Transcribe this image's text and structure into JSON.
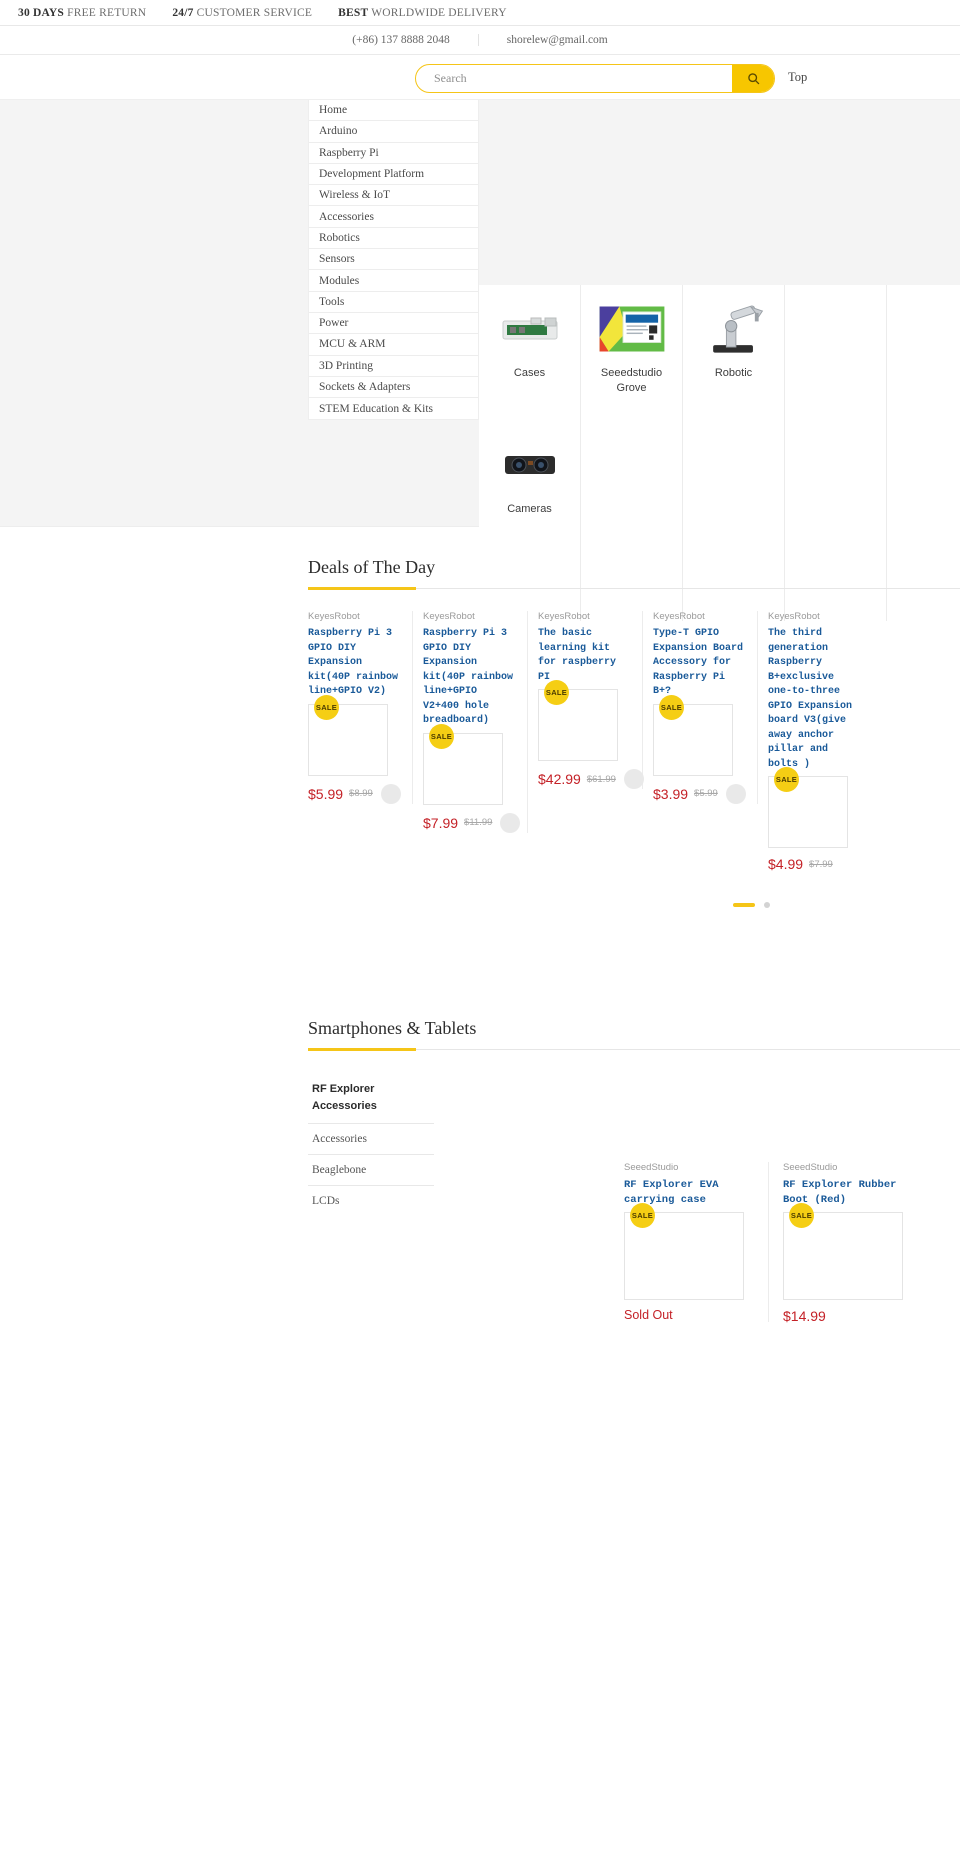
{
  "announcement": {
    "items": [
      {
        "strong": "30 DAYS",
        "rest": "FREE RETURN"
      },
      {
        "strong": "24/7",
        "rest": "CUSTOMER SERVICE"
      },
      {
        "strong": "BEST",
        "rest": "WORLDWIDE DELIVERY"
      }
    ]
  },
  "contact": {
    "phone": "(+86) 137 8888 2048",
    "email": "shorelew@gmail.com"
  },
  "search": {
    "placeholder": "Search",
    "value": "",
    "button_icon": "search-icon",
    "top_link": "Top"
  },
  "mega_menu": {
    "items": [
      {
        "label": "Home"
      },
      {
        "label": "Arduino"
      },
      {
        "label": "Raspberry Pi"
      },
      {
        "label": "Development Platform"
      },
      {
        "label": "Wireless & IoT"
      },
      {
        "label": "Accessories"
      },
      {
        "label": "Robotics"
      },
      {
        "label": "Sensors"
      },
      {
        "label": "Modules"
      },
      {
        "label": "Tools"
      },
      {
        "label": "Power"
      },
      {
        "label": "MCU & ARM"
      },
      {
        "label": "3D Printing"
      },
      {
        "label": "Sockets & Adapters"
      },
      {
        "label": "STEM Education & Kits"
      }
    ]
  },
  "mega_panel": {
    "categories": [
      {
        "label": "Cases",
        "image": "raspberry-pi-clear-case-image"
      },
      {
        "label": "Cameras",
        "image": "camera-module-image"
      },
      {
        "label": "Seeedstudio Grove",
        "image": "grove-base-kit-box-image"
      },
      {
        "label": "Robotic",
        "image": "robotic-arm-image"
      }
    ]
  },
  "deals": {
    "title": "Deals of The Day",
    "products": [
      {
        "vendor": "KeyesRobot",
        "title": "Raspberry Pi 3 GPIO DIY Expansion kit(40P rainbow line+GPIO V2)",
        "badge": "SALE",
        "price": "$5.99",
        "compare_price": "$8.99",
        "sold_out": false
      },
      {
        "vendor": "KeyesRobot",
        "title": "Raspberry Pi 3 GPIO DIY Expansion kit(40P rainbow line+GPIO V2+400 hole breadboard)",
        "badge": "SALE",
        "price": "$7.99",
        "compare_price": "$11.99",
        "sold_out": false
      },
      {
        "vendor": "KeyesRobot",
        "title": "The basic learning kit for raspberry PI",
        "badge": "SALE",
        "price": "$42.99",
        "compare_price": "$61.99",
        "sold_out": false
      },
      {
        "vendor": "KeyesRobot",
        "title": "Type-T GPIO Expansion Board Accessory for Raspberry Pi B+?",
        "badge": "SALE",
        "price": "$3.99",
        "compare_price": "$5.99",
        "sold_out": false
      },
      {
        "vendor": "KeyesRobot",
        "title": "The third generation Raspberry B+exclusive one-to-three GPIO Expansion board V3(give away anchor pillar and bolts )",
        "badge": "SALE",
        "price": "$4.99",
        "compare_price": "$7.99",
        "sold_out": false
      }
    ],
    "pagination": {
      "active_index": 0,
      "count": 2
    }
  },
  "smartphones": {
    "title": "Smartphones & Tablets",
    "tabs": [
      {
        "label": "RF Explorer Accessories",
        "active": true
      },
      {
        "label": "Accessories",
        "active": false
      },
      {
        "label": "Beaglebone",
        "active": false
      },
      {
        "label": "LCDs",
        "active": false
      }
    ],
    "products": [
      {
        "vendor": "SeeedStudio",
        "title": "RF Explorer EVA carrying case",
        "badge": "SALE",
        "price": "Sold Out",
        "compare_price": "",
        "sold_out": true
      },
      {
        "vendor": "SeeedStudio",
        "title": "RF Explorer Rubber Boot (Red)",
        "badge": "SALE",
        "price": "$14.99",
        "compare_price": "",
        "sold_out": false
      }
    ]
  },
  "colors": {
    "accent": "#f5c518",
    "price": "#c42127",
    "title_link": "#1a5a99"
  }
}
